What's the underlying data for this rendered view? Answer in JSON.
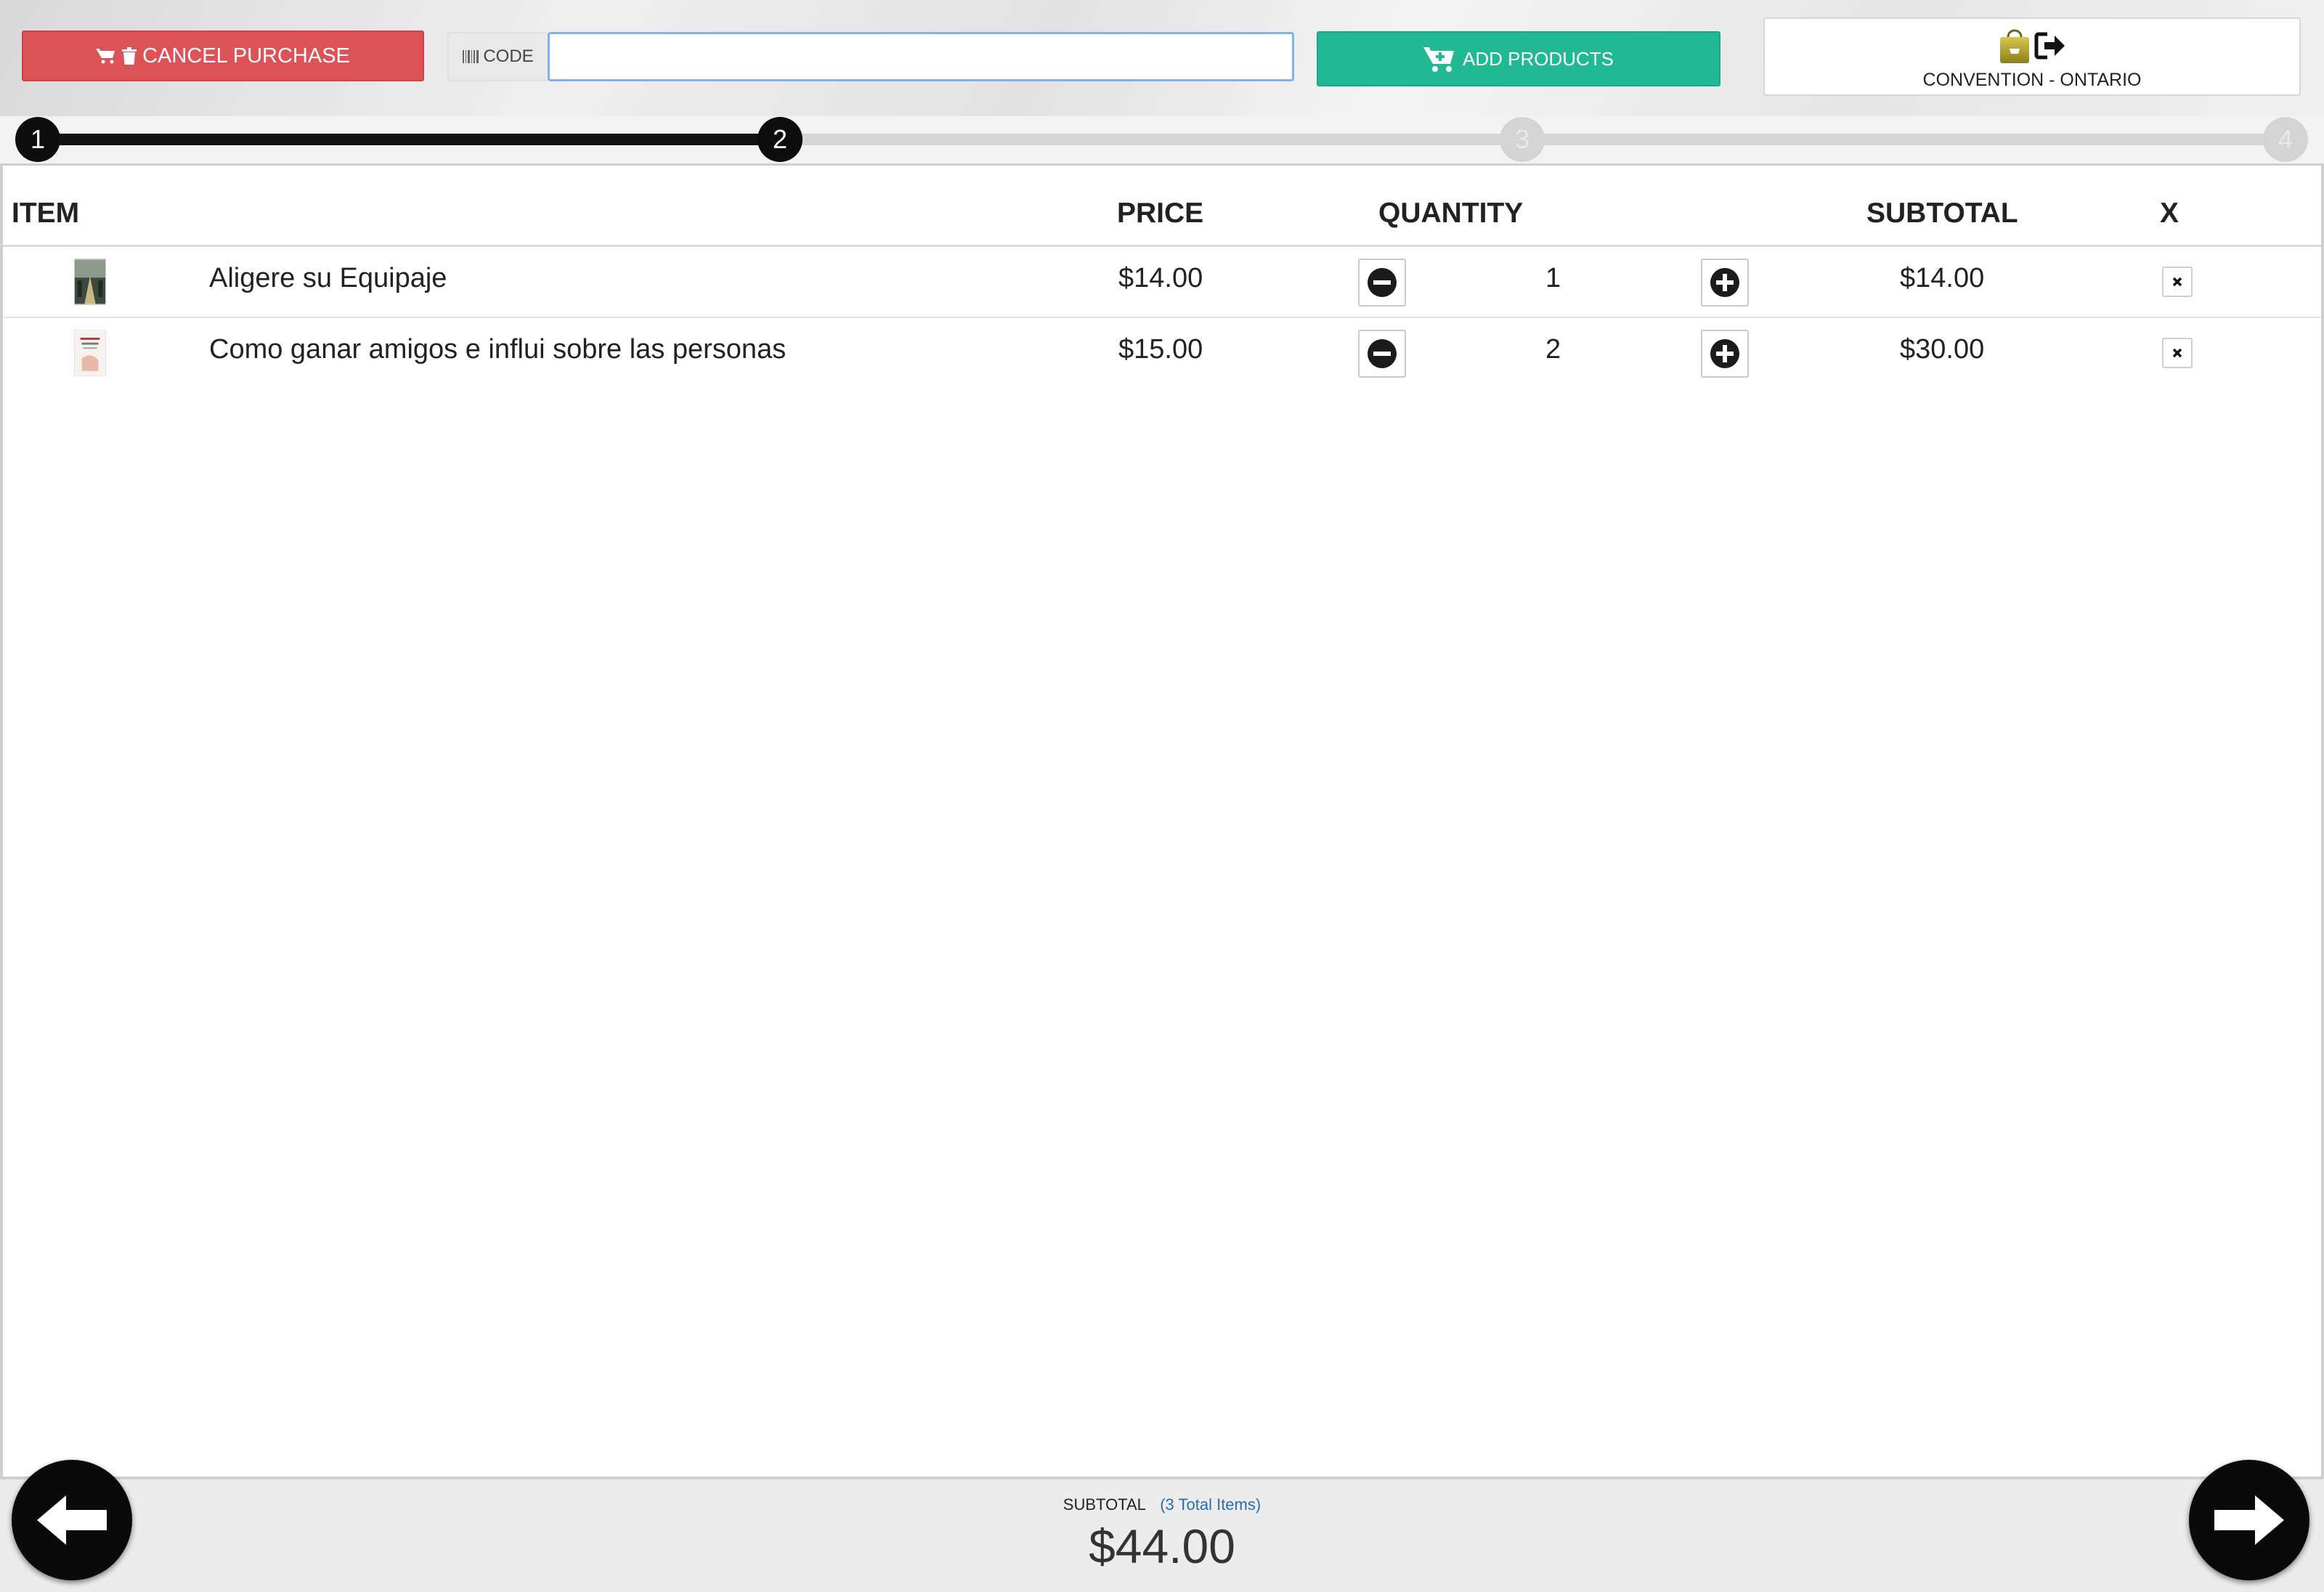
{
  "toolbar": {
    "cancel_label": "CANCEL PURCHASE",
    "code_label": "CODE",
    "code_value": "",
    "add_label": "ADD PRODUCTS",
    "store_label": "CONVENTION - ONTARIO"
  },
  "progress": {
    "steps": [
      "1",
      "2",
      "3",
      "4"
    ],
    "current_step": 2
  },
  "table": {
    "headers": {
      "item": "ITEM",
      "price": "PRICE",
      "quantity": "QUANTITY",
      "subtotal": "SUBTOTAL",
      "remove": "X"
    },
    "rows": [
      {
        "name": "Aligere su Equipaje",
        "price": "$14.00",
        "qty": "1",
        "subtotal": "$14.00"
      },
      {
        "name": "Como ganar amigos e influi sobre las personas",
        "price": "$15.00",
        "qty": "2",
        "subtotal": "$30.00"
      }
    ]
  },
  "footer": {
    "subtotal_label": "SUBTOTAL",
    "total_items": "(3 Total Items)",
    "total": "$44.00"
  },
  "colors": {
    "cancel": "#dc5257",
    "add": "#21b994",
    "step_done": "#0d0d0d",
    "step_todo": "#d4d4d4",
    "link": "#2a6db0"
  },
  "icons": {
    "cancel": [
      "cart-icon",
      "trash-icon"
    ],
    "code": "barcode-icon",
    "add": "cart-plus-icon",
    "store": [
      "shopping-bag-icon",
      "sign-out-icon"
    ],
    "qty": [
      "minus-circle-icon",
      "plus-circle-icon"
    ],
    "remove": "close-icon",
    "nav": [
      "arrow-left-icon",
      "arrow-right-icon"
    ]
  }
}
